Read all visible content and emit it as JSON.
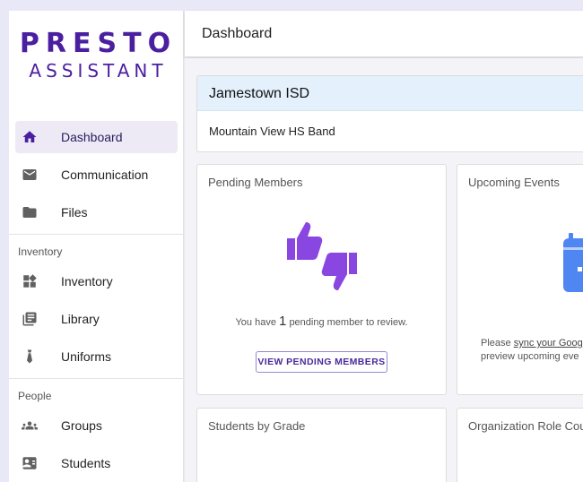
{
  "logo": {
    "line1": "PRESTO",
    "line2": "ASSISTANT"
  },
  "sidebar": {
    "items": [
      {
        "label": "Dashboard",
        "icon": "home-icon"
      },
      {
        "label": "Communication",
        "icon": "mail-icon"
      },
      {
        "label": "Files",
        "icon": "folder-icon"
      }
    ],
    "sections": [
      {
        "label": "Inventory",
        "items": [
          {
            "label": "Inventory",
            "icon": "widgets-icon"
          },
          {
            "label": "Library",
            "icon": "library-icon"
          },
          {
            "label": "Uniforms",
            "icon": "tie-icon"
          }
        ]
      },
      {
        "label": "People",
        "items": [
          {
            "label": "Groups",
            "icon": "groups-icon"
          },
          {
            "label": "Students",
            "icon": "id-card-icon"
          }
        ]
      }
    ]
  },
  "header": {
    "title": "Dashboard"
  },
  "org": {
    "district": "Jamestown ISD",
    "program": "Mountain View HS Band"
  },
  "cards": {
    "pending": {
      "title": "Pending Members",
      "text_before": "You have",
      "count": "1",
      "text_after": "pending member to review.",
      "button_label": "VIEW PENDING MEMBERS"
    },
    "events": {
      "title": "Upcoming Events",
      "text_prefix": "Please",
      "link_text": "sync your Goog",
      "line2": "preview upcoming eve"
    },
    "students_by_grade": {
      "title": "Students by Grade"
    },
    "org_roles": {
      "title": "Organization Role Cou"
    }
  },
  "colors": {
    "brand": "#4a1fa0",
    "accent_purple": "#8a46e0",
    "calendar_blue": "#4f86f2",
    "org_header_bg": "#e4f0fc"
  }
}
